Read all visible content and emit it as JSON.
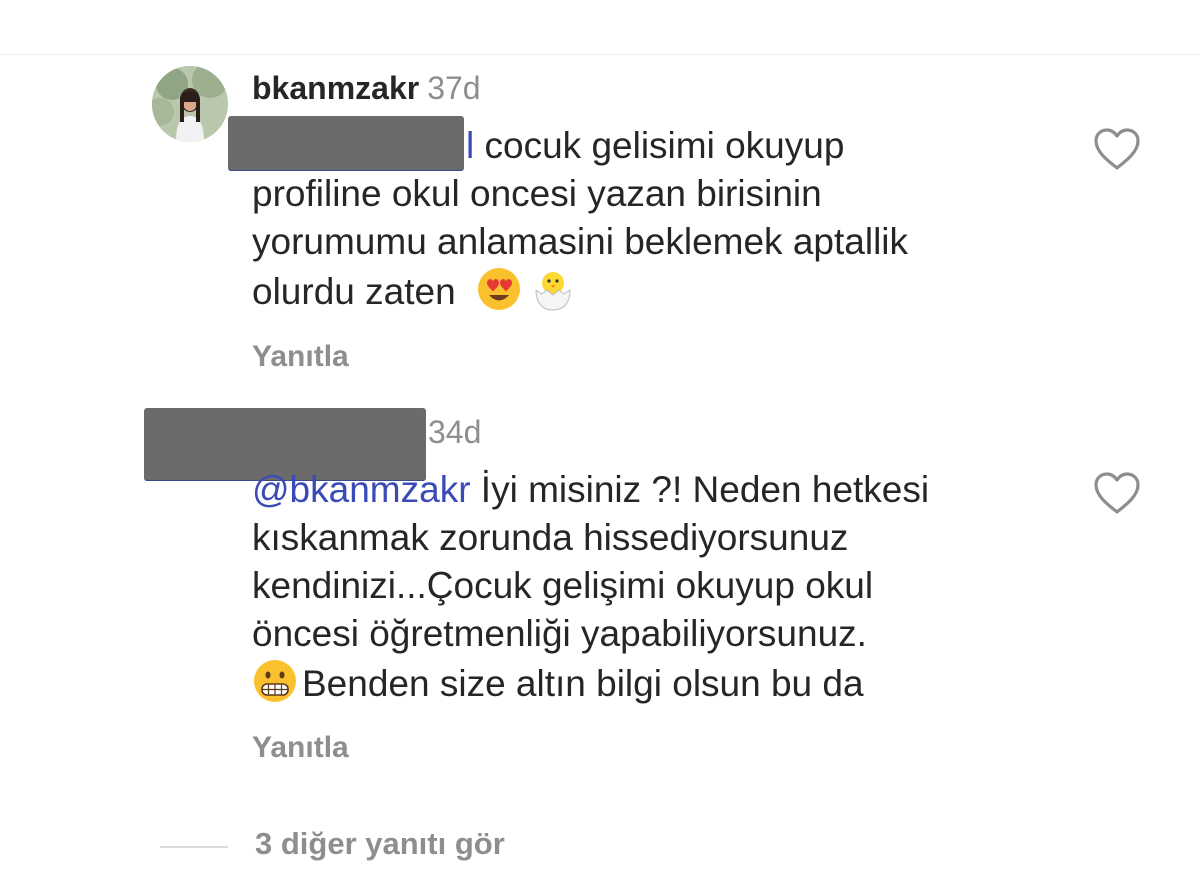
{
  "comments": [
    {
      "username": "bkanmzakr",
      "time": "37d",
      "mention_link": "l",
      "lines": [
        "cocuk gelisimi okuyup",
        "profiline okul oncesi yazan birisinin",
        "yorumumu anlamasini beklemek aptallik",
        "olurdu zaten"
      ],
      "emojis": [
        "heart-eyes-emoji",
        "hatching-chick-emoji"
      ],
      "reply_label": "Yanıtla"
    },
    {
      "time": "34d",
      "mention": "@bkanmzakr",
      "lines": [
        "İyi misiniz ?! Neden hetkesi",
        "kıskanmak zorunda hissediyorsunuz",
        "kendinizi...Çocuk gelişimi okuyup okul",
        "öncesi öğretmenliği yapabiliyorsunuz.",
        "Benden size altın bilgi olsun bu da"
      ],
      "emojis": [
        "grimacing-emoji"
      ],
      "reply_label": "Yanıtla"
    }
  ],
  "view_more_label": "3 diğer yanıtı gör",
  "colors": {
    "text": "#262626",
    "muted": "#8e8e8e",
    "mention": "#3a4ab6",
    "redaction": "#6b6b6b"
  }
}
